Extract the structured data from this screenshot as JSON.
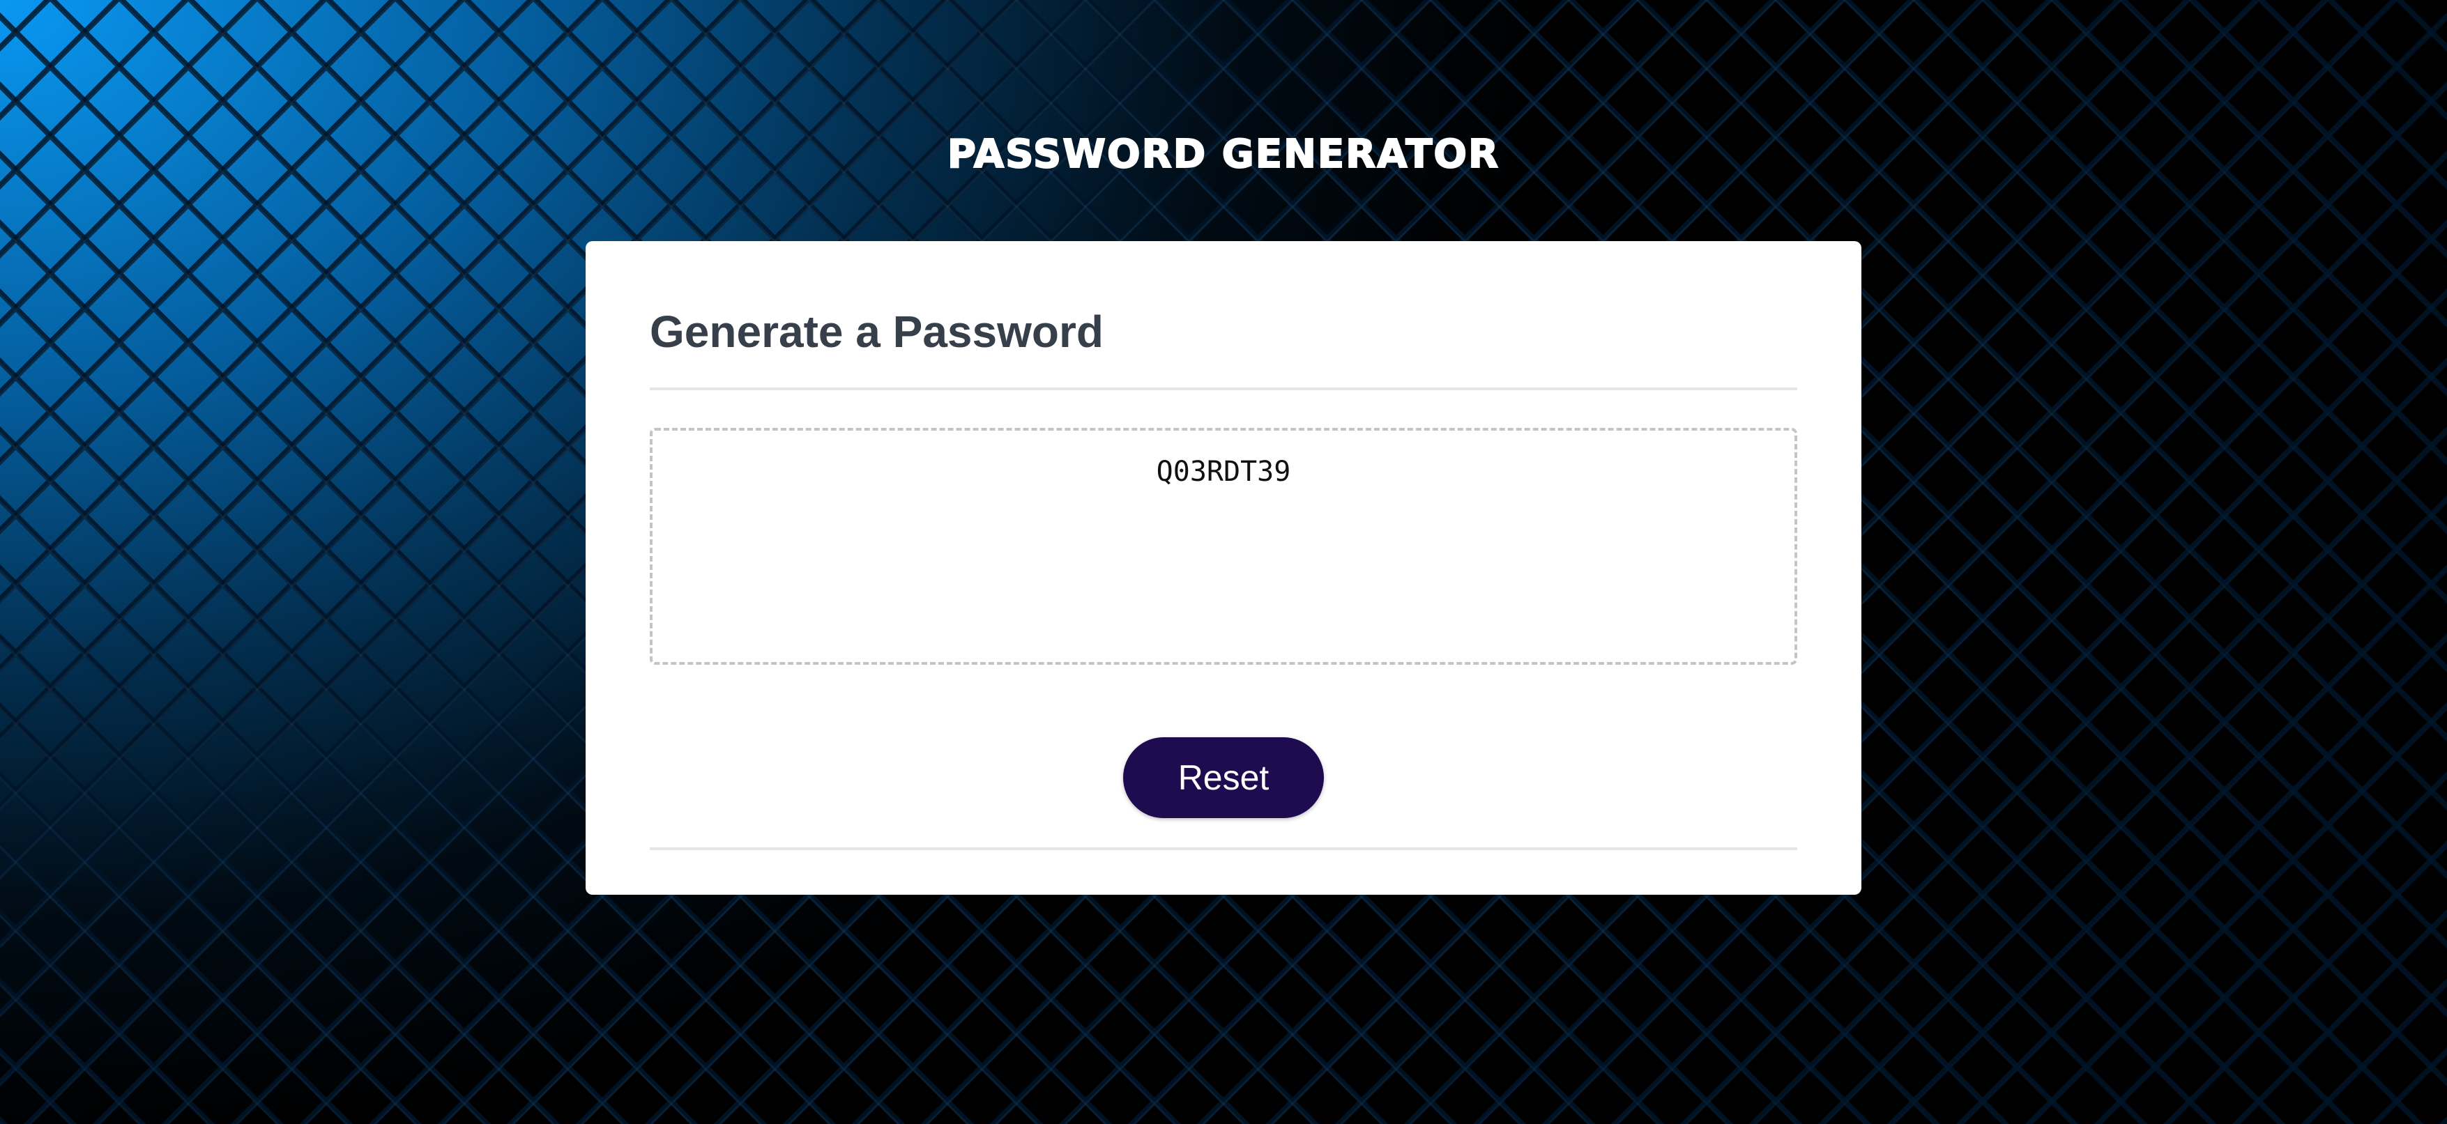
{
  "page": {
    "title": "PASSWORD GENERATOR"
  },
  "card": {
    "heading": "Generate a Password",
    "password_value": "Q03RDT39",
    "reset_label": "Reset"
  },
  "colors": {
    "background_accent": "#0aa0ff",
    "background_base": "#000000",
    "button": "#1f0b4f",
    "card": "#ffffff",
    "heading_text": "#37404a",
    "dashed_border": "#c4c4c4"
  }
}
